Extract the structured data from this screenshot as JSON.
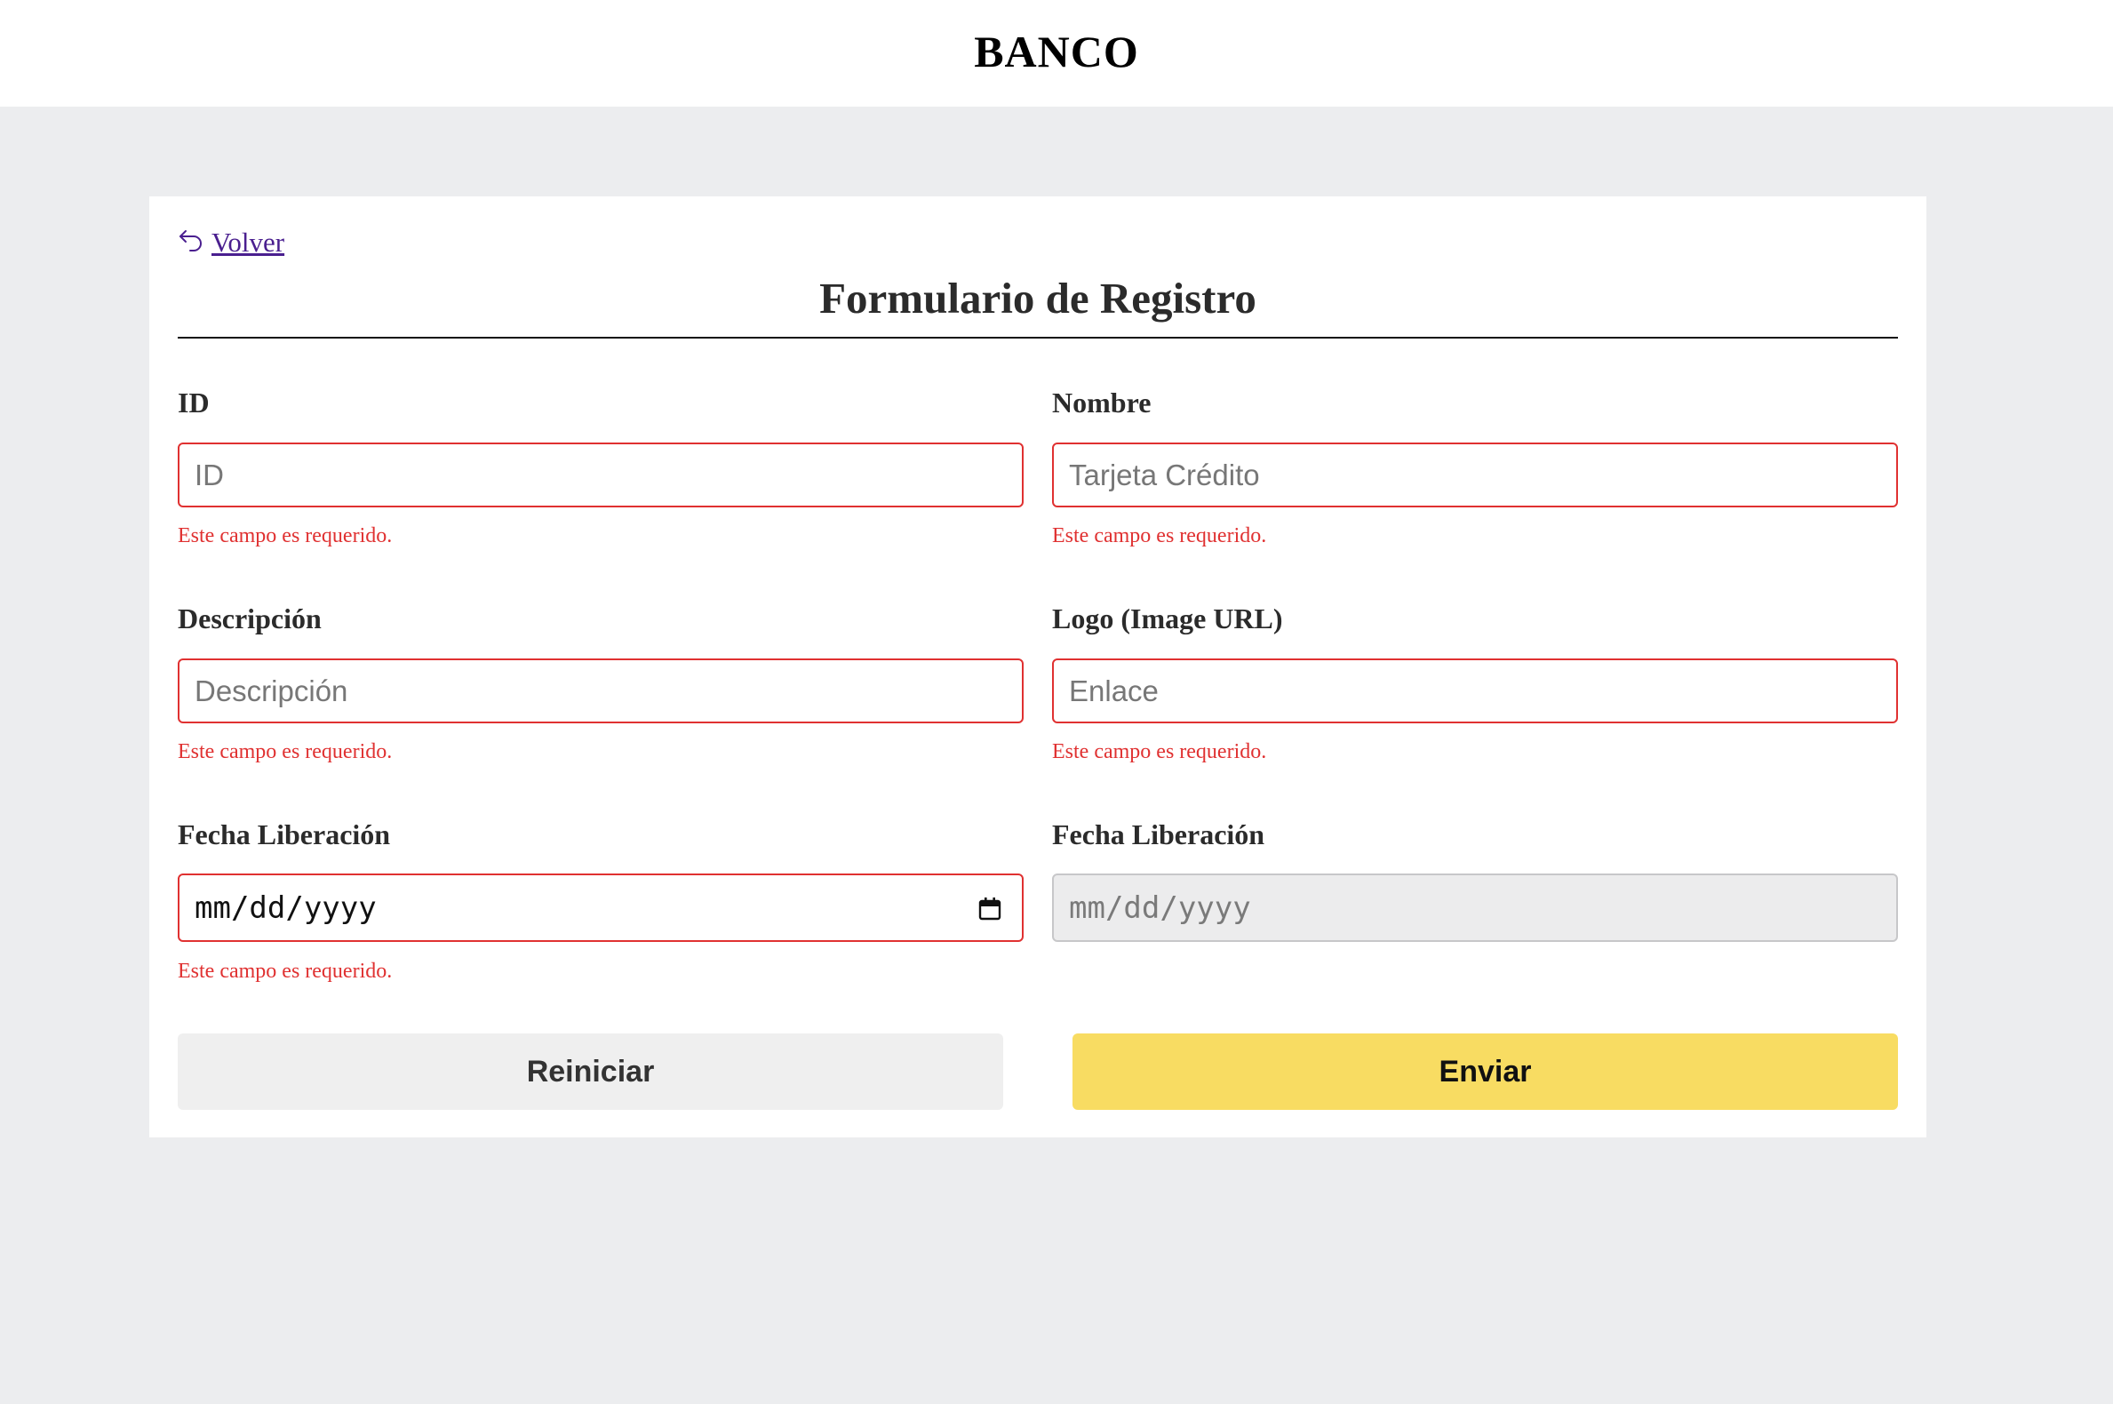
{
  "header": {
    "brand": "BANCO"
  },
  "form": {
    "back_label": " Volver",
    "title": "Formulario de Registro",
    "fields": [
      {
        "label": "ID",
        "placeholder": "ID",
        "error": "Este campo es requerido."
      },
      {
        "label": "Nombre",
        "placeholder": "Tarjeta Crédito",
        "error": "Este campo es requerido."
      },
      {
        "label": "Descripción",
        "placeholder": "Descripción",
        "error": "Este campo es requerido."
      },
      {
        "label": "Logo (Image URL)",
        "placeholder": "Enlace",
        "error": "Este campo es requerido."
      },
      {
        "label": "Fecha Liberación",
        "placeholder": "mm/dd/yyyy",
        "error": "Este campo es requerido."
      },
      {
        "label": "Fecha Liberación",
        "placeholder": "mm/dd/yyyy",
        "disabled": true
      }
    ],
    "reset_label": "Reiniciar",
    "submit_label": "Enviar"
  },
  "colors": {
    "error": "#e03131",
    "submit": "#f8dc62",
    "reset": "#efefef",
    "link": "#4a1f8f",
    "background": "#ecedef"
  },
  "icons": {
    "back": "undo-arrow-icon",
    "date": "calendar-icon"
  }
}
